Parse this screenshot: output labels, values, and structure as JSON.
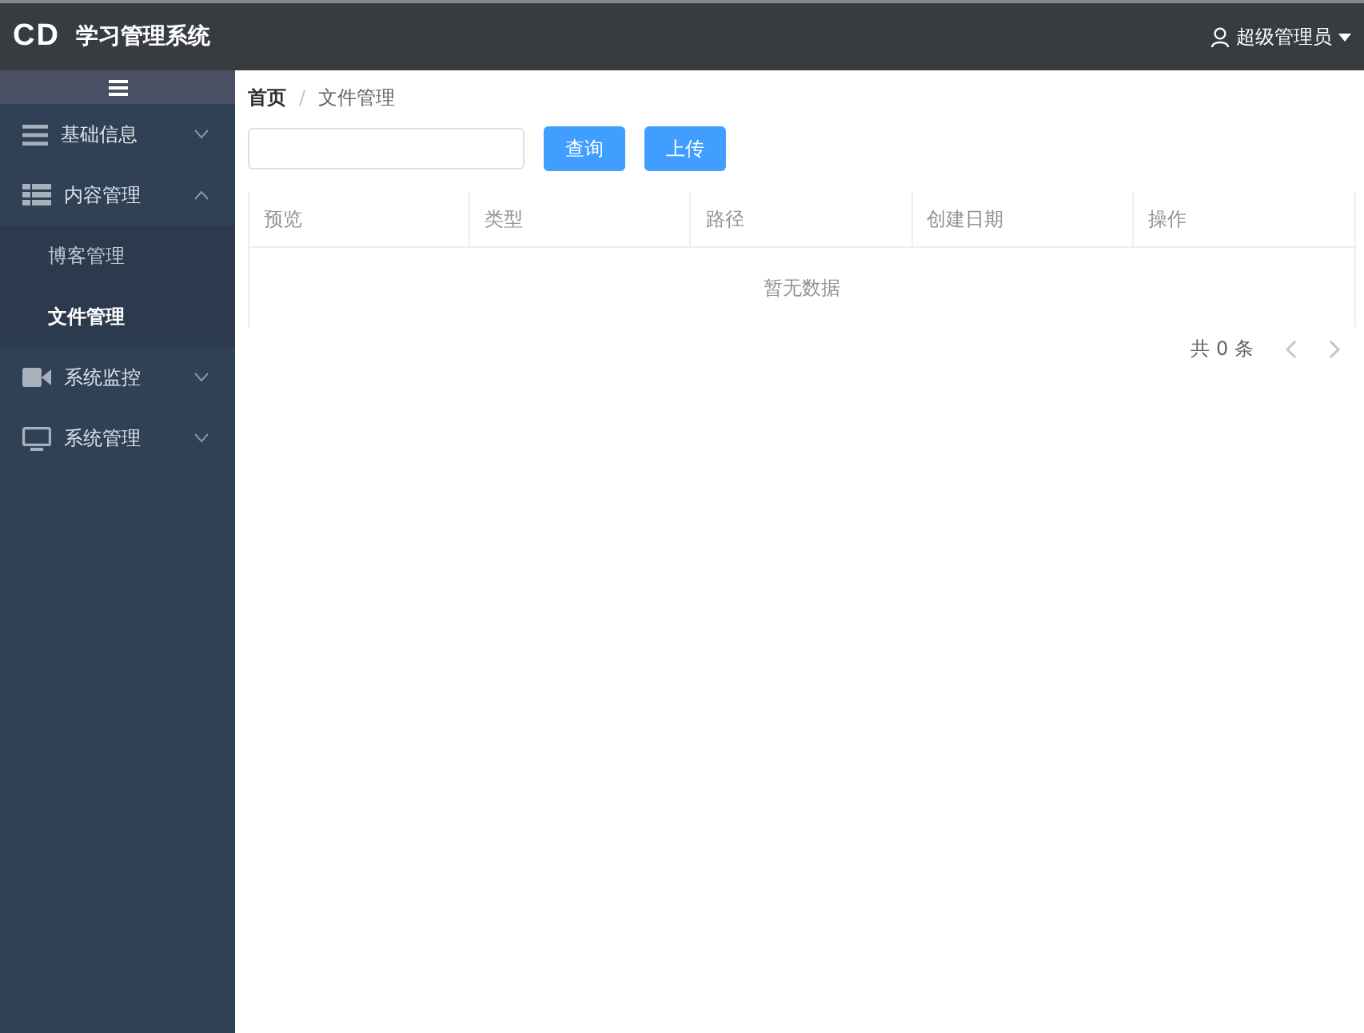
{
  "header": {
    "logo": "CD",
    "title": "学习管理系统",
    "user": "超级管理员"
  },
  "sidebar": {
    "items": [
      {
        "label": "基础信息",
        "expanded": false
      },
      {
        "label": "内容管理",
        "expanded": true,
        "children": [
          {
            "label": "博客管理",
            "selected": false
          },
          {
            "label": "文件管理",
            "selected": true
          }
        ]
      },
      {
        "label": "系统监控",
        "expanded": false
      },
      {
        "label": "系统管理",
        "expanded": false
      }
    ]
  },
  "breadcrumb": {
    "items": [
      "首页",
      "文件管理"
    ],
    "separator": "/"
  },
  "toolbar": {
    "buttons": [
      "查询",
      "上传"
    ]
  },
  "table": {
    "columns": [
      "预览",
      "类型",
      "路径",
      "创建日期",
      "操作"
    ],
    "empty_text": "暂无数据"
  },
  "pagination": {
    "total": "共 0 条"
  }
}
